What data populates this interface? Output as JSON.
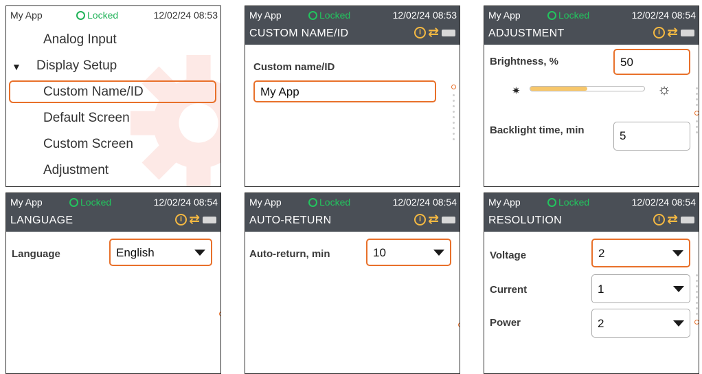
{
  "status": {
    "app_name": "My App",
    "lock_label": "Locked",
    "datetime_a": "12/02/24 08:53",
    "datetime_b": "12/02/24 08:54"
  },
  "menu": {
    "items": [
      "Analog Input",
      "Display Setup",
      "Custom Name/ID",
      "Default Screen",
      "Custom Screen",
      "Adjustment"
    ],
    "selected": "Custom Name/ID"
  },
  "custom_name": {
    "title": "CUSTOM NAME/ID",
    "label": "Custom name/ID",
    "value": "My App"
  },
  "adjustment": {
    "title": "ADJUSTMENT",
    "brightness_label": "Brightness, %",
    "brightness_value": "50",
    "brightness_level": 0.5,
    "backlight_label": "Backlight time, min",
    "backlight_value": "5"
  },
  "language": {
    "title": "LANGUAGE",
    "label": "Language",
    "value": "English"
  },
  "auto_return": {
    "title": "AUTO-RETURN",
    "label": "Auto-return, min",
    "value": "10"
  },
  "resolution": {
    "title": "RESOLUTION",
    "rows": [
      {
        "label": "Voltage",
        "value": "2"
      },
      {
        "label": "Current",
        "value": "1"
      },
      {
        "label": "Power",
        "value": "2"
      }
    ]
  },
  "colors": {
    "accent": "#e8702a",
    "locked": "#22c55e",
    "icon": "#f5b942",
    "header": "#4a4f56"
  }
}
